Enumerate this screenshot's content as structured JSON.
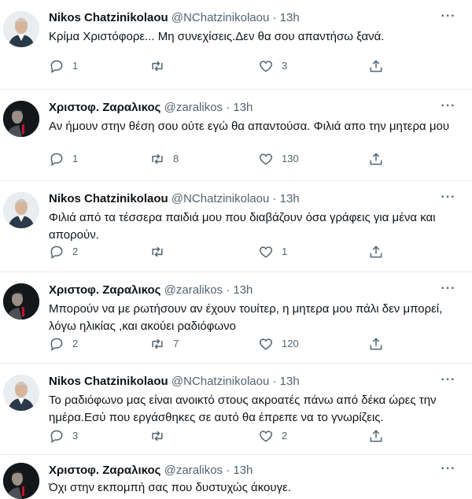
{
  "icons": {
    "reply": "reply-icon",
    "retweet": "retweet-icon",
    "like": "heart-icon",
    "share": "share-icon",
    "more": "more-icon"
  },
  "colors": {
    "text": "#0f1419",
    "secondary": "#536471",
    "divider": "#e6ecf0"
  },
  "tweets": [
    {
      "name": "Nikos Chatzinikolaou",
      "handle": "@NChatzinikolaou · 13h",
      "text": "Κρίμα Χριστόφορε... Μη συνεχίσεις.Δεν θα σου απαντήσω ξανά.",
      "replies": "1",
      "retweets": "",
      "likes": "3"
    },
    {
      "name": "Χριστοφ. Ζαραλικος",
      "handle": "@zaralikos · 13h",
      "text": "Αν ήμουν στην θέση σου ούτε εγώ θα απαντούσα. Φιλιά απο την μητερα μου",
      "replies": "1",
      "retweets": "8",
      "likes": "130"
    },
    {
      "name": "Nikos Chatzinikolaou",
      "handle": "@NChatzinikolaou · 13h",
      "text": "Φιλιά από τα τέσσερα παιδιά μου που διαβάζουν όσα γράφεις για μένα και απορούν.",
      "replies": "2",
      "retweets": "",
      "likes": "1"
    },
    {
      "name": "Χριστοφ. Ζαραλικος",
      "handle": "@zaralikos · 13h",
      "text": "Μπορούν να με ρωτήσουν αν έχουν  τουίτερ,  η μητερα μου πάλι δεν μπορεί, λόγω ηλικίας ,και ακούει ραδιόφωνο",
      "replies": "2",
      "retweets": "7",
      "likes": "120"
    },
    {
      "name": "Nikos Chatzinikolaou",
      "handle": "@NChatzinikolaou · 13h",
      "text": "Το ραδιόφωνο μας είναι ανοικτό στους ακροατές πάνω από δέκα ώρες την ημέρα.Εσύ που εργάσθηκες σε αυτό θα έπρεπε να το γνωρίζεις.",
      "replies": "3",
      "retweets": "",
      "likes": "2"
    },
    {
      "name": "Χριστοφ. Ζαραλικος",
      "handle": "@zaralikos · 13h",
      "text": "Όχι στην εκπομπή σας που δυστυχώς άκουγε."
    }
  ]
}
